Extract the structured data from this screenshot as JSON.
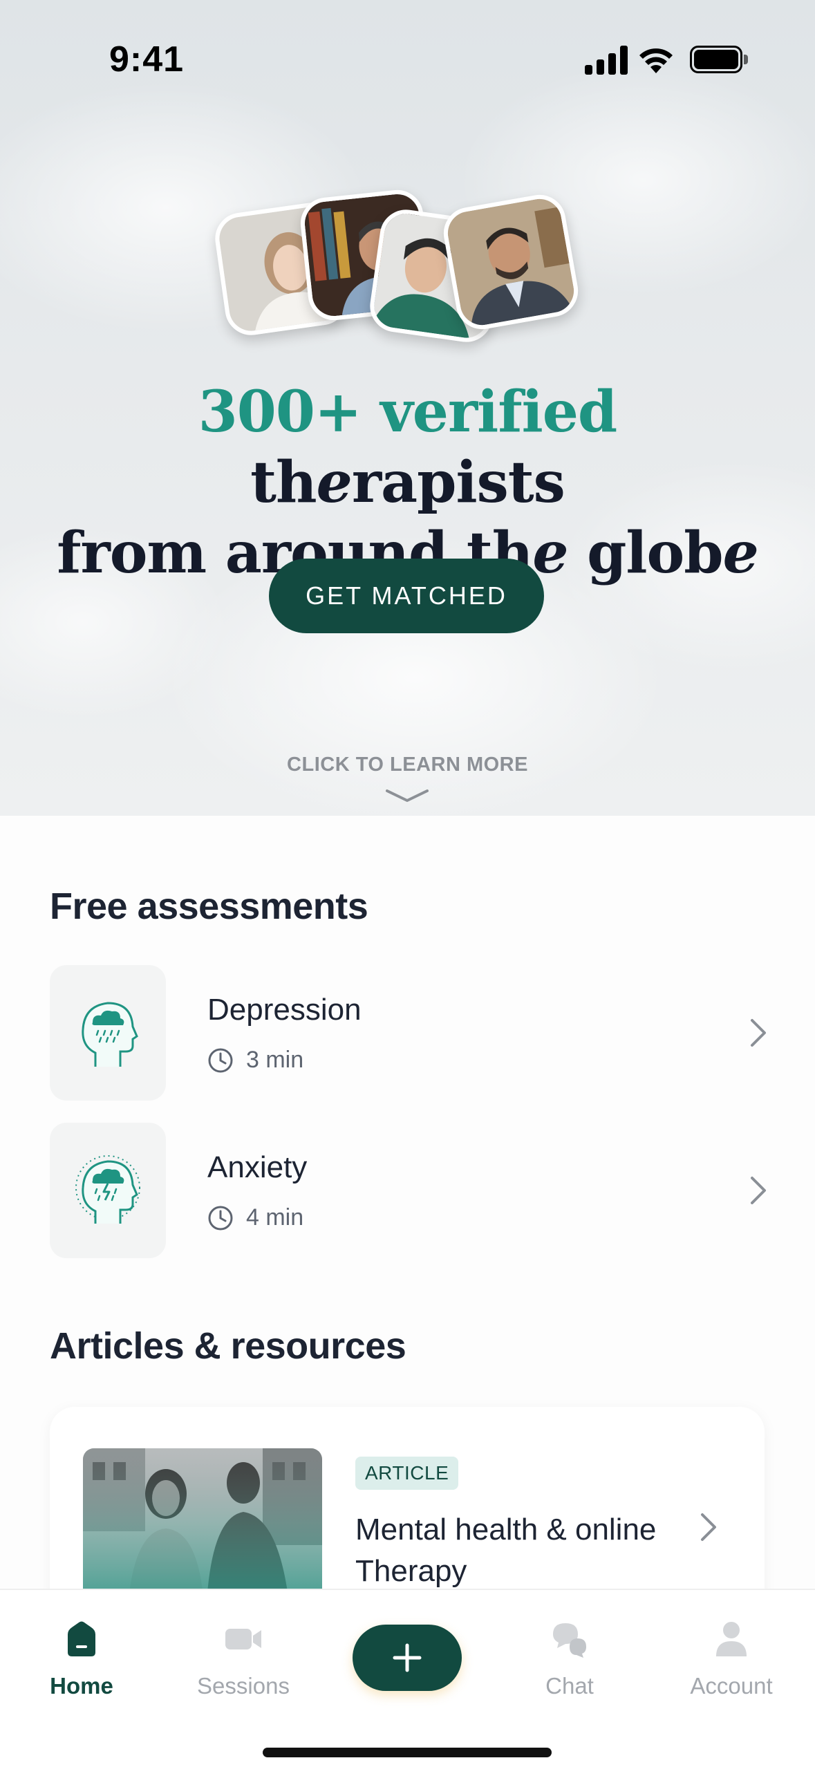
{
  "status_bar": {
    "time": "9:41"
  },
  "hero": {
    "headline_accent": "300+ verified",
    "headline_line1_rest_a": " th",
    "headline_line1_rest_b": "e",
    "headline_line1_rest_c": "rapists",
    "headline_line2_a": "from around th",
    "headline_line2_b": "e",
    "headline_line2_c": " glob",
    "headline_line2_d": "e",
    "cta_label": "GET MATCHED",
    "learn_more": "CLICK TO LEARN MORE"
  },
  "assessments": {
    "title": "Free assessments",
    "items": [
      {
        "name": "Depression",
        "duration": "3 min",
        "icon": "head-cloud-rain-icon"
      },
      {
        "name": "Anxiety",
        "duration": "4 min",
        "icon": "head-storm-icon"
      }
    ]
  },
  "articles": {
    "title": "Articles & resources",
    "items": [
      {
        "badge": "ARTICLE",
        "title": "Mental health & online Therapy"
      }
    ]
  },
  "tabbar": {
    "tabs": [
      {
        "label": "Home",
        "icon": "home-icon",
        "active": true
      },
      {
        "label": "Sessions",
        "icon": "video-camera-icon",
        "active": false
      },
      {
        "label": "Chat",
        "icon": "chat-bubbles-icon",
        "active": false
      },
      {
        "label": "Account",
        "icon": "person-icon",
        "active": false
      }
    ],
    "fab_icon": "plus-icon"
  },
  "colors": {
    "brand_dark": "#124a40",
    "brand_accent": "#1f9482",
    "text_dark": "#1d2433",
    "muted": "#a3a7ad"
  }
}
